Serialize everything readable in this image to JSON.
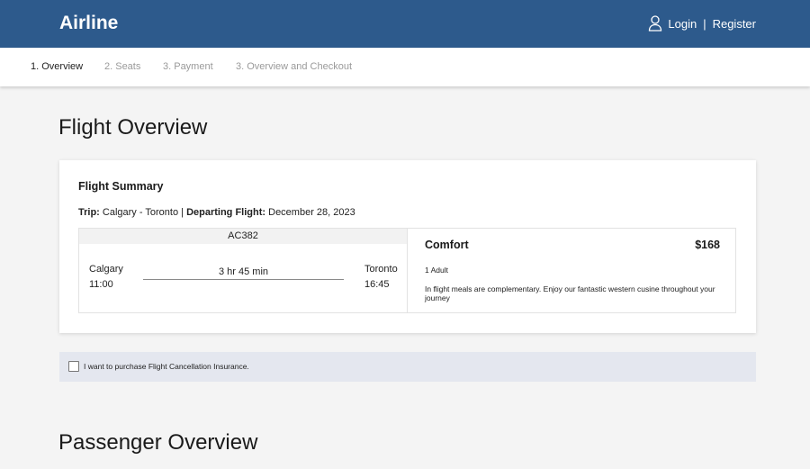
{
  "header": {
    "brand": "Airline",
    "login_label": "Login",
    "separator": "|",
    "register_label": "Register"
  },
  "steps": [
    {
      "label": "1. Overview",
      "active": true
    },
    {
      "label": "2. Seats",
      "active": false
    },
    {
      "label": "3. Payment",
      "active": false
    },
    {
      "label": "3. Overview and Checkout",
      "active": false
    }
  ],
  "page_title": "Flight Overview",
  "summary": {
    "title": "Flight Summary",
    "trip_label": "Trip:",
    "trip_value": "Calgary - Toronto |",
    "departing_label": "Departing Flight:",
    "departing_value": "December 28, 2023"
  },
  "flight": {
    "number": "AC382",
    "origin_city": "Calgary",
    "origin_time": "11:00",
    "duration": "3 hr 45 min",
    "dest_city": "Toronto",
    "dest_time": "16:45"
  },
  "fare": {
    "class": "Comfort",
    "price": "$168",
    "passengers": "1 Adult",
    "description": "In flight meals are complementary. Enjoy our fantastic western cusine throughout your journey"
  },
  "insurance": {
    "label": "I want to purchase Flight Cancellation Insurance.",
    "checked": false
  },
  "passenger_title": "Passenger Overview",
  "colors": {
    "header_bg": "#2d5a8c",
    "insurance_bg": "#e4e7ef",
    "page_bg": "#f4f4f4"
  },
  "icons": {
    "user": "user-icon"
  }
}
